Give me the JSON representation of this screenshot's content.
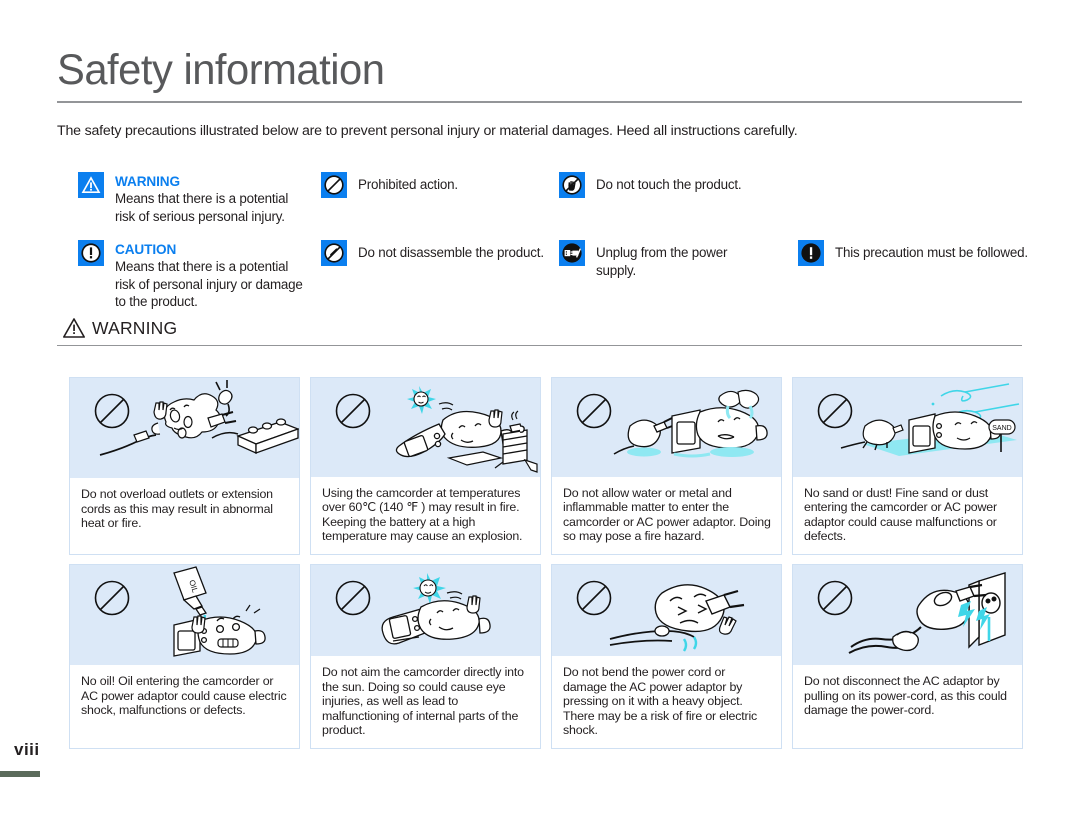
{
  "page": {
    "title": "Safety information",
    "intro": "The safety precautions illustrated below are to prevent personal injury or material damages. Heed all instructions carefully.",
    "number": "viii",
    "accent_color": "#0b7fef",
    "art_bg_color": "#dce9f8",
    "card_border_color": "#cfe0f3",
    "rule_color": "#939598",
    "footer_bar_color": "#5b6b5b"
  },
  "legend": {
    "columns": [
      {
        "items": [
          {
            "icon": "warning-triangle-icon",
            "title": "WARNING",
            "desc": "Means that there is a potential risk of serious personal injury."
          },
          {
            "icon": "caution-exclamation-icon",
            "title": "CAUTION",
            "desc": "Means that there is a potential risk of personal injury or damage to the product."
          }
        ]
      },
      {
        "items": [
          {
            "icon": "prohibited-action-icon",
            "title": "",
            "desc": "Prohibited action."
          },
          {
            "icon": "do-not-disassemble-icon",
            "title": "",
            "desc": "Do not disassemble the product."
          }
        ]
      },
      {
        "items": [
          {
            "icon": "do-not-touch-icon",
            "title": "",
            "desc": "Do not touch the product."
          },
          {
            "icon": "unplug-power-icon",
            "title": "",
            "desc": "Unplug from the power supply."
          }
        ]
      },
      {
        "items": [
          {
            "icon": "must-follow-icon",
            "title": "",
            "desc": "This precaution must be followed."
          }
        ]
      }
    ]
  },
  "section": {
    "icon": "warning-triangle-outline-icon",
    "label": "WARNING"
  },
  "cards": [
    {
      "art": "overloaded-outlet-illustration",
      "badge": "prohibited-circle-icon",
      "text": "Do not overload outlets or extension cords as this may result in abnormal heat or fire."
    },
    {
      "art": "camcorder-high-temperature-illustration",
      "badge": "prohibited-circle-icon",
      "text": "Using the camcorder at temperatures over 60℃ (140 ℉ ) may result in fire. Keeping the battery at a high temperature may cause an explosion."
    },
    {
      "art": "camcorder-water-metal-illustration",
      "badge": "prohibited-circle-icon",
      "text": "Do not allow water or metal and inflammable matter to enter the camcorder or AC power adaptor. Doing so may pose a fire hazard."
    },
    {
      "art": "camcorder-sand-dust-illustration",
      "badge": "prohibited-circle-icon",
      "text": "No sand or dust! Fine sand or dust entering the camcorder or AC power adaptor could cause malfunctions or defects."
    },
    {
      "art": "camcorder-oil-illustration",
      "badge": "prohibited-circle-icon",
      "text": "No oil! Oil entering the camcorder or AC power adaptor could cause electric shock, malfunctions or defects."
    },
    {
      "art": "camcorder-sun-illustration",
      "badge": "prohibited-circle-icon",
      "text": "Do not aim the camcorder directly into the sun. Doing so could cause eye injuries, as well as lead to malfunctioning of internal parts of the product."
    },
    {
      "art": "bent-power-cord-illustration",
      "badge": "prohibited-circle-icon",
      "text": "Do not bend the power cord or damage the AC power adaptor by pressing on it with a heavy object. There may be a risk of fire or electric shock."
    },
    {
      "art": "pulling-power-cord-illustration",
      "badge": "prohibited-circle-icon",
      "text": "Do not disconnect the AC adaptor by pulling on its power-cord, as this could damage the power-cord."
    }
  ],
  "illustration_labels": {
    "sand_sign": "SAND",
    "oil_bottle": "OIL"
  }
}
